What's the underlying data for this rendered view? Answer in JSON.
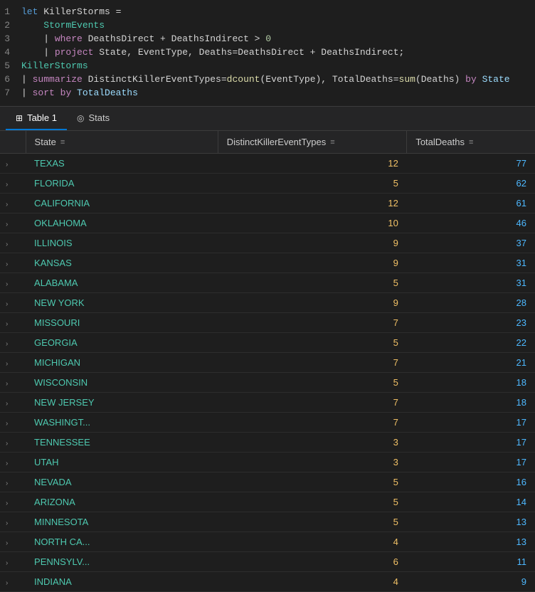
{
  "code": {
    "lines": [
      {
        "number": 1,
        "tokens": [
          {
            "text": "let",
            "class": "kw-let"
          },
          {
            "text": " KillerStorms = ",
            "class": "kw-op"
          }
        ]
      },
      {
        "number": 2,
        "tokens": [
          {
            "text": "    StormEvents",
            "class": "str-event"
          }
        ]
      },
      {
        "number": 3,
        "tokens": [
          {
            "text": "    | ",
            "class": "kw-pipe"
          },
          {
            "text": "where",
            "class": "kw-where"
          },
          {
            "text": " DeathsDirect + DeathsIndirect > ",
            "class": "kw-op"
          },
          {
            "text": "0",
            "class": "val-num"
          }
        ]
      },
      {
        "number": 4,
        "tokens": [
          {
            "text": "    | ",
            "class": "kw-pipe"
          },
          {
            "text": "project",
            "class": "kw-project"
          },
          {
            "text": " State, EventType, Deaths=DeathsDirect + DeathsIndirect;",
            "class": "kw-op"
          }
        ]
      },
      {
        "number": 5,
        "tokens": [
          {
            "text": "KillerStorms",
            "class": "str-event"
          }
        ]
      },
      {
        "number": 6,
        "tokens": [
          {
            "text": "| ",
            "class": "kw-pipe"
          },
          {
            "text": "summarize",
            "class": "kw-summarize"
          },
          {
            "text": " DistinctKillerEventTypes=",
            "class": "kw-op"
          },
          {
            "text": "dcount",
            "class": "fn-dcount"
          },
          {
            "text": "(EventType), TotalDeaths=",
            "class": "kw-op"
          },
          {
            "text": "sum",
            "class": "fn-sum"
          },
          {
            "text": "(Deaths) ",
            "class": "kw-op"
          },
          {
            "text": "by",
            "class": "kw-by"
          },
          {
            "text": " State",
            "class": "str-state"
          }
        ]
      },
      {
        "number": 7,
        "tokens": [
          {
            "text": "| ",
            "class": "kw-pipe"
          },
          {
            "text": "sort",
            "class": "kw-sort"
          },
          {
            "text": " ",
            "class": "kw-op"
          },
          {
            "text": "by",
            "class": "kw-by"
          },
          {
            "text": " TotalDeaths",
            "class": "str-state"
          }
        ]
      }
    ]
  },
  "tabs": [
    {
      "label": "Table 1",
      "icon": "⊞",
      "active": true
    },
    {
      "label": "Stats",
      "icon": "◎",
      "active": false
    }
  ],
  "table": {
    "columns": [
      {
        "key": "expand",
        "label": ""
      },
      {
        "key": "state",
        "label": "State"
      },
      {
        "key": "distinct",
        "label": "DistinctKillerEventTypes"
      },
      {
        "key": "total",
        "label": "TotalDeaths"
      }
    ],
    "rows": [
      {
        "state": "TEXAS",
        "distinct": 12,
        "total": 77
      },
      {
        "state": "FLORIDA",
        "distinct": 5,
        "total": 62
      },
      {
        "state": "CALIFORNIA",
        "distinct": 12,
        "total": 61
      },
      {
        "state": "OKLAHOMA",
        "distinct": 10,
        "total": 46
      },
      {
        "state": "ILLINOIS",
        "distinct": 9,
        "total": 37
      },
      {
        "state": "KANSAS",
        "distinct": 9,
        "total": 31
      },
      {
        "state": "ALABAMA",
        "distinct": 5,
        "total": 31
      },
      {
        "state": "NEW YORK",
        "distinct": 9,
        "total": 28
      },
      {
        "state": "MISSOURI",
        "distinct": 7,
        "total": 23
      },
      {
        "state": "GEORGIA",
        "distinct": 5,
        "total": 22
      },
      {
        "state": "MICHIGAN",
        "distinct": 7,
        "total": 21
      },
      {
        "state": "WISCONSIN",
        "distinct": 5,
        "total": 18
      },
      {
        "state": "NEW JERSEY",
        "distinct": 7,
        "total": 18
      },
      {
        "state": "WASHINGT...",
        "distinct": 7,
        "total": 17
      },
      {
        "state": "TENNESSEE",
        "distinct": 3,
        "total": 17
      },
      {
        "state": "UTAH",
        "distinct": 3,
        "total": 17
      },
      {
        "state": "NEVADA",
        "distinct": 5,
        "total": 16
      },
      {
        "state": "ARIZONA",
        "distinct": 5,
        "total": 14
      },
      {
        "state": "MINNESOTA",
        "distinct": 5,
        "total": 13
      },
      {
        "state": "NORTH CA...",
        "distinct": 4,
        "total": 13
      },
      {
        "state": "PENNSYLV...",
        "distinct": 6,
        "total": 11
      },
      {
        "state": "INDIANA",
        "distinct": 4,
        "total": 9
      }
    ]
  }
}
